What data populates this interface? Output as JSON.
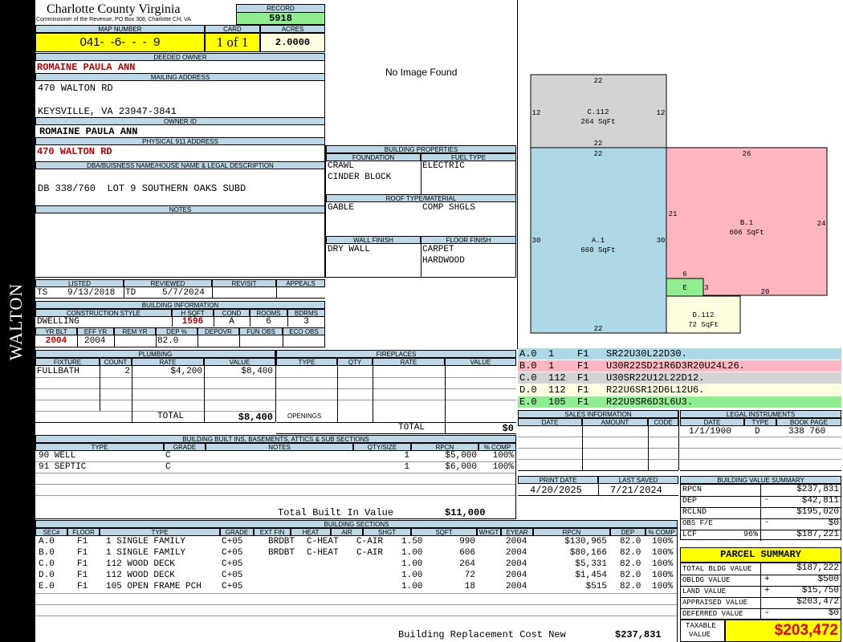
{
  "county": {
    "title": "Charlotte County Virginia",
    "subtitle": "Commissioner of the Revenue, PO Box 308, Charlotte CH, VA",
    "side_label": "WALTON"
  },
  "record": {
    "label": "RECORD",
    "value": "5918"
  },
  "map": {
    "label": "MAP NUMBER",
    "value": "041-  -6-  -  -  9"
  },
  "card": {
    "label": "CARD",
    "value": "1 of 1"
  },
  "acres": {
    "label": "ACRES",
    "value": "2.0000"
  },
  "deeded_owner": {
    "label": "DEEDED OWNER",
    "value": "ROMAINE PAULA ANN"
  },
  "mailing": {
    "label": "MAILING ADDRESS",
    "line1": "470 WALTON RD",
    "line2": "KEYSVILLE, VA 23947-3841"
  },
  "owner_id": {
    "label": "OWNER ID",
    "value": "ROMAINE PAULA ANN"
  },
  "physical": {
    "label": "PHYSICAL 911 ADDRESS",
    "value": "470 WALTON RD"
  },
  "legal": {
    "label": "DBA/BUISNESS NAME/HOUSE NAME & LEGAL DESCRIPTION",
    "value": "DB 338/760  LOT 9 SOUTHERN OAKS SUBD"
  },
  "notes": {
    "label": "NOTES"
  },
  "image": {
    "text": "No Image Found"
  },
  "listed": {
    "labels": [
      "LISTED",
      "REVIEWED",
      "REVISIT",
      "APPEALS"
    ],
    "listed_by": "TS",
    "listed_date": "9/13/2018",
    "reviewed_by": "TD",
    "reviewed_date": "5/7/2024"
  },
  "building_info": {
    "label": "BUILDING INFORMATION",
    "h1": [
      "CONSTRUCTION STYLE",
      "H SQFT",
      "COND",
      "ROOMS",
      "BDRMS"
    ],
    "style": "DWELLING",
    "hsqft": "1596",
    "cond": "A",
    "rooms": "6",
    "bdrms": "3",
    "h2": [
      "YR BLT",
      "EFF YR",
      "REM YR",
      "DEP %",
      "DEPOVR",
      "FUN OBS",
      "ECO OBS"
    ],
    "yr_blt": "2004",
    "eff_yr": "2004",
    "dep": "82.0"
  },
  "building_props": {
    "label": "BUILDING PROPERTIES",
    "foundation_label": "FOUNDATION",
    "fuel_label": "FUEL TYPE",
    "foundation1": "CRAWL",
    "foundation2": "CINDER BLOCK",
    "fuel": "ELECTRIC",
    "roof_label": "ROOF TYPE/MATERIAL",
    "roof1": "GABLE",
    "roof2": "COMP SHGLS",
    "wall_label": "WALL FINISH",
    "floor_label": "FLOOR FINISH",
    "wall": "DRY WALL",
    "floor1": "CARPET",
    "floor2": "HARDWOOD"
  },
  "plumbing": {
    "label": "PLUMBING",
    "headers": [
      "FIXTURE",
      "COUNT",
      "RATE",
      "VALUE"
    ],
    "rows": [
      {
        "fixture": "FULLBATH",
        "count": "2",
        "rate": "$4,200",
        "value": "$8,400"
      }
    ],
    "total_label": "TOTAL",
    "total": "$8,400"
  },
  "fireplaces": {
    "label": "FIREPLACES",
    "headers": [
      "TYPE",
      "QTY",
      "RATE",
      "VALUE"
    ],
    "openings_label": "OPENINGS",
    "total_label": "TOTAL",
    "total": "$0"
  },
  "builtins": {
    "label": "BUILDING BUILT INS, BASEMENTS, ATTICS & SUB SECTIONS",
    "headers": [
      "TYPE",
      "GRADE",
      "NOTES",
      "QTY/SIZE",
      "RPCN",
      "% COMP"
    ],
    "rows": [
      {
        "type": "90 WELL",
        "grade": "C",
        "qty": "1",
        "rpcn": "$5,000",
        "comp": "100%"
      },
      {
        "type": "91 SEPTIC",
        "grade": "C",
        "qty": "1",
        "rpcn": "$6,000",
        "comp": "100%"
      }
    ],
    "total_label": "Total Built In Value",
    "total": "$11,000"
  },
  "sections": {
    "label": "BUILDING SECTIONS",
    "headers": [
      "SEC#",
      "FLOOR",
      "TYPE",
      "GRADE",
      "EXT FIN",
      "HEAT",
      "AIR",
      "SHGT",
      "SQFT",
      "WHGT",
      "EYEAR",
      "RPCN",
      "DEP",
      "% COMP"
    ],
    "rows": [
      {
        "sec": "A.0",
        "floor": "F1",
        "type": "1 SINGLE FAMILY",
        "grade": "C+05",
        "ext": "BRDBT",
        "heat": "C-HEAT",
        "air": "C-AIR",
        "shgt": "1.50",
        "sqft": "990",
        "eyear": "2004",
        "rpcn": "$130,965",
        "dep": "82.0",
        "comp": "100%"
      },
      {
        "sec": "B.0",
        "floor": "F1",
        "type": "1 SINGLE FAMILY",
        "grade": "C+05",
        "ext": "BRDBT",
        "heat": "C-HEAT",
        "air": "C-AIR",
        "shgt": "1.00",
        "sqft": "606",
        "eyear": "2004",
        "rpcn": "$80,166",
        "dep": "82.0",
        "comp": "100%"
      },
      {
        "sec": "C.0",
        "floor": "F1",
        "type": "112 WOOD DECK",
        "grade": "C+05",
        "ext": "",
        "heat": "",
        "air": "",
        "shgt": "1.00",
        "sqft": "264",
        "eyear": "2004",
        "rpcn": "$5,331",
        "dep": "82.0",
        "comp": "100%"
      },
      {
        "sec": "D.0",
        "floor": "F1",
        "type": "112 WOOD DECK",
        "grade": "C+05",
        "ext": "",
        "heat": "",
        "air": "",
        "shgt": "1.00",
        "sqft": "72",
        "eyear": "2004",
        "rpcn": "$1,454",
        "dep": "82.0",
        "comp": "100%"
      },
      {
        "sec": "E.0",
        "floor": "F1",
        "type": "105 OPEN FRAME PCH",
        "grade": "C+05",
        "ext": "",
        "heat": "",
        "air": "",
        "shgt": "1.00",
        "sqft": "18",
        "eyear": "2004",
        "rpcn": "$515",
        "dep": "82.0",
        "comp": "100%"
      }
    ],
    "brcn_label": "Building Replacement Cost New",
    "brcn": "$237,831"
  },
  "sketch": {
    "C": {
      "label": "C.112",
      "area": "264 SqFt",
      "top": "22",
      "left": "12",
      "right": "12",
      "bottom": "22"
    },
    "A": {
      "label": "A.1",
      "area": "660 SqFt",
      "top": "22",
      "left": "30",
      "right": "30",
      "bottom": "22"
    },
    "B": {
      "label": "B.1",
      "area": "606 SqFt",
      "top": "26",
      "left": "21",
      "right": "24",
      "bottom": "20"
    },
    "E": {
      "label": "E",
      "left": "6",
      "right": "3"
    },
    "D": {
      "label": "D.112",
      "area": "72 SqFt"
    },
    "colors": {
      "C": "#d3d3d3",
      "A": "#add8e6",
      "B": "#ffb6c1",
      "E": "#90ee90",
      "D": "#fffde0"
    }
  },
  "vectors": [
    {
      "text": "A.0  1    F1   SR22U30L22D30.",
      "color": "#add8e6"
    },
    {
      "text": "B.0  1    F1   U30R22SD21R6D3R20U24L26.",
      "color": "#ffb6c1"
    },
    {
      "text": "C.0  112  F1   U30SR22U12L22D12.",
      "color": "#d3d3d3"
    },
    {
      "text": "D.0  112  F1   R22U6SR12D6L12U6.",
      "color": "#fffde0"
    },
    {
      "text": "E.0  105  F1   R22U9SR6D3L6U3.",
      "color": "#90ee90"
    }
  ],
  "sales": {
    "label": "SALES INFORMATION",
    "headers": [
      "DATE",
      "AMOUNT",
      "CODE"
    ]
  },
  "legal_inst": {
    "label": "LEGAL INSTRUMENTS",
    "headers": [
      "DATE",
      "TYPE",
      "BOOK PAGE"
    ],
    "date": "1/1/1900",
    "type": "D",
    "bookpage": "338 760"
  },
  "print": {
    "label": "PRINT DATE",
    "value": "4/20/2025"
  },
  "saved": {
    "label": "LAST SAVED",
    "value": "7/21/2024"
  },
  "bvs": {
    "label": "BUILDING VALUE SUMMARY",
    "rows": [
      {
        "k": "RPCN",
        "s": "",
        "v": "$237,831"
      },
      {
        "k": "DEP",
        "s": "-",
        "v": "$42,811"
      },
      {
        "k": "RCLND",
        "s": "",
        "v": "$195,020"
      },
      {
        "k": "OBS F/E",
        "s": "-",
        "v": "$0"
      },
      {
        "k": "LCF",
        "p": "96%",
        "s": "",
        "v": "$187,221"
      }
    ]
  },
  "parcel": {
    "label": "PARCEL SUMMARY",
    "rows": [
      {
        "k": "TOTAL BLDG VALUE",
        "s": "",
        "v": "$187,222"
      },
      {
        "k": "OBLDG VALUE",
        "s": "+",
        "v": "$500"
      },
      {
        "k": "LAND VALUE",
        "s": "+",
        "v": "$15,750"
      },
      {
        "k": "APPRAISED VALUE",
        "s": "",
        "v": "$203,472"
      },
      {
        "k": "DEFERRED VALUE",
        "s": "-",
        "v": "$0"
      }
    ],
    "taxable_label1": "TAXABLE",
    "taxable_label2": "VALUE",
    "taxable": "$203,472"
  }
}
